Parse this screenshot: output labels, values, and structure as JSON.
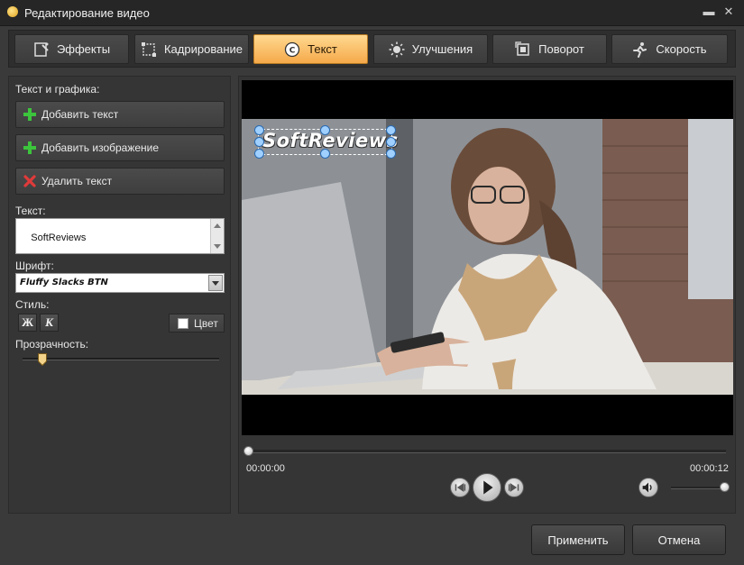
{
  "window": {
    "title": "Редактирование видео",
    "minimize_glyph": "▬",
    "close_glyph": "✕"
  },
  "tabs": [
    {
      "label": "Эффекты",
      "icon": "effects-icon",
      "active": false
    },
    {
      "label": "Кадрирование",
      "icon": "crop-icon",
      "active": false
    },
    {
      "label": "Текст",
      "icon": "text-icon",
      "active": true
    },
    {
      "label": "Улучшения",
      "icon": "enhance-icon",
      "active": false
    },
    {
      "label": "Поворот",
      "icon": "rotate-icon",
      "active": false
    },
    {
      "label": "Скорость",
      "icon": "speed-icon",
      "active": false
    }
  ],
  "left": {
    "section_title": "Текст и графика:",
    "add_text": "Добавить текст",
    "add_image": "Добавить изображение",
    "delete_text": "Удалить текст",
    "text_label": "Текст:",
    "text_value": "SoftReviews",
    "font_label": "Шрифт:",
    "font_value": "Fluffy Slacks BTN",
    "style_label": "Стиль:",
    "bold_label": "Ж",
    "italic_label": "К",
    "color_label": "Цвет",
    "opacity_label": "Прозрачность:",
    "opacity_value": 0.1
  },
  "player": {
    "overlay_text": "SoftReviews",
    "time_start": "00:00:00",
    "time_end": "00:00:12",
    "seek_position": 0,
    "volume": 1.0
  },
  "footer": {
    "apply": "Применить",
    "cancel": "Отмена"
  },
  "colors": {
    "accent_tab": "#f5a94a",
    "plus_green": "#3cc43c",
    "delete_red": "#e03a3a"
  }
}
